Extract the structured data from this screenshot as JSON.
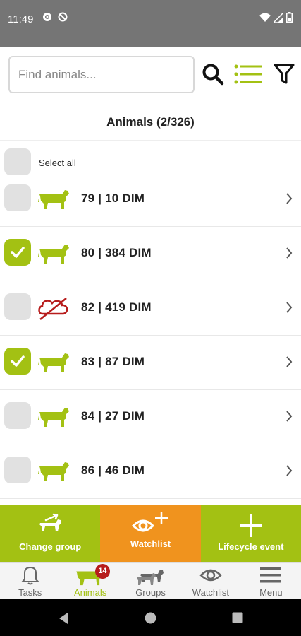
{
  "status_bar": {
    "time": "11:49"
  },
  "search": {
    "placeholder": "Find animals..."
  },
  "list": {
    "title": "Animals (2/326)",
    "select_all_label": "Select all",
    "rows": [
      {
        "label": "79 | 10 DIM",
        "checked": false,
        "icon": "cow-icon"
      },
      {
        "label": "80 | 384 DIM",
        "checked": true,
        "icon": "cow-icon"
      },
      {
        "label": "82 | 419 DIM",
        "checked": false,
        "icon": "dry-cow-icon"
      },
      {
        "label": "83 | 87 DIM",
        "checked": true,
        "icon": "cow-icon"
      },
      {
        "label": "84 | 27 DIM",
        "checked": false,
        "icon": "cow-icon"
      },
      {
        "label": "86 | 46 DIM",
        "checked": false,
        "icon": "cow-icon"
      }
    ]
  },
  "actions": {
    "change_group": "Change group",
    "watchlist": "Watchlist",
    "lifecycle_event": "Lifecycle event"
  },
  "nav": {
    "tasks": "Tasks",
    "animals": "Animals",
    "animals_badge": "14",
    "groups": "Groups",
    "watchlist": "Watchlist",
    "menu": "Menu"
  },
  "colors": {
    "accent_green": "#a3c113",
    "accent_orange": "#f0931e",
    "alert_red": "#b71c1c",
    "status_gray": "#757575"
  }
}
